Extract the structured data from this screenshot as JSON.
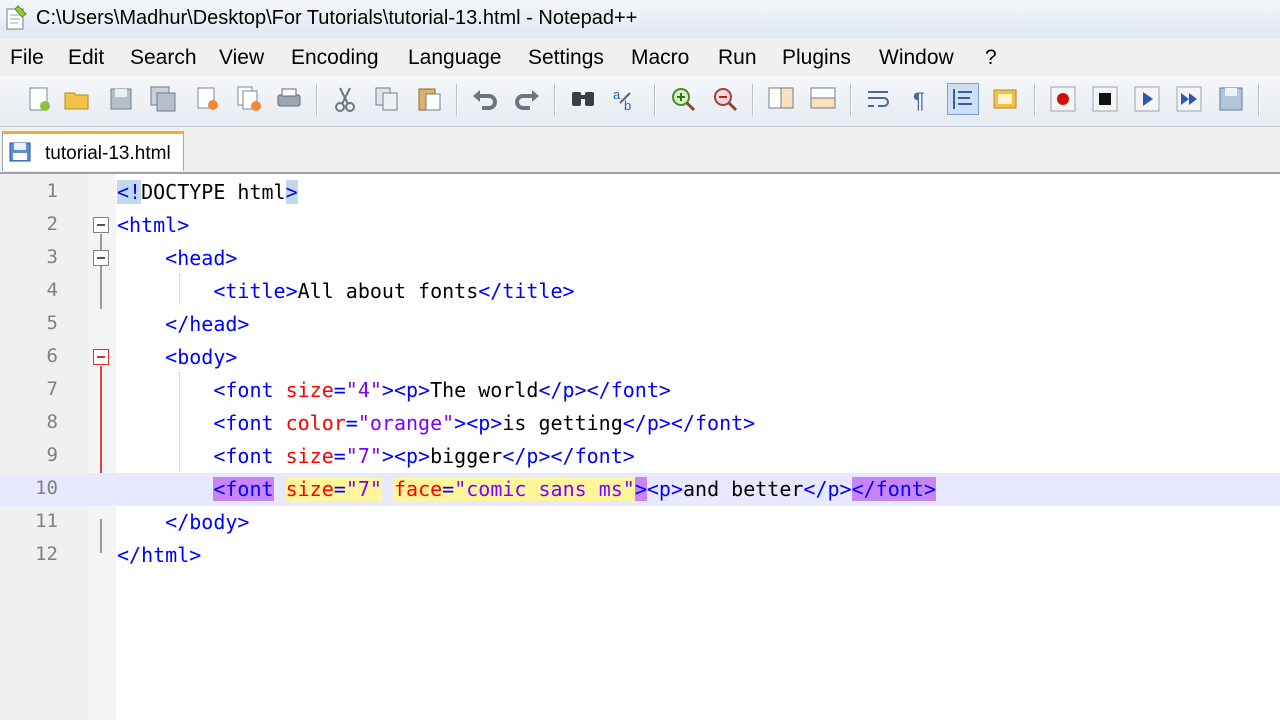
{
  "window": {
    "title": "C:\\Users\\Madhur\\Desktop\\For Tutorials\\tutorial-13.html - Notepad++"
  },
  "menu": [
    "File",
    "Edit",
    "Search",
    "View",
    "Encoding",
    "Language",
    "Settings",
    "Macro",
    "Run",
    "Plugins",
    "Window",
    "?"
  ],
  "toolbar": {
    "buttons": [
      "new-file",
      "open-file",
      "save",
      "save-all",
      "close",
      "close-all",
      "print",
      "cut",
      "copy",
      "paste",
      "undo",
      "redo",
      "find",
      "replace",
      "zoom-in",
      "zoom-out",
      "sync-vertical",
      "sync-horizontal",
      "word-wrap",
      "show-all-characters",
      "indent-guide",
      "doc-map",
      "macro-record",
      "macro-stop",
      "macro-play",
      "macro-run-multiple",
      "macro-save"
    ]
  },
  "tabs": [
    {
      "label": "tutorial-13.html",
      "active": true
    }
  ],
  "editor": {
    "current_line": 10,
    "lines": [
      {
        "n": "1",
        "tokens": [
          {
            "t": "<!",
            "c": "tag",
            "hl": "blue"
          },
          {
            "t": "DOCTYPE html",
            "c": "txt"
          },
          {
            "t": ">",
            "c": "tag",
            "hl": "blue"
          }
        ]
      },
      {
        "n": "2",
        "tokens": [
          {
            "t": "<html>",
            "c": "tag"
          }
        ]
      },
      {
        "n": "3",
        "tokens": [
          {
            "t": "    <head>",
            "c": "tag"
          }
        ]
      },
      {
        "n": "4",
        "tokens": [
          {
            "t": "        <title>",
            "c": "tag"
          },
          {
            "t": "All about fonts",
            "c": "txt"
          },
          {
            "t": "</title>",
            "c": "tag"
          }
        ]
      },
      {
        "n": "5",
        "tokens": [
          {
            "t": "    </head>",
            "c": "tag"
          }
        ]
      },
      {
        "n": "6",
        "tokens": [
          {
            "t": "    <body>",
            "c": "tag"
          }
        ]
      },
      {
        "n": "7",
        "tokens": [
          {
            "t": "        <font ",
            "c": "tag"
          },
          {
            "t": "size",
            "c": "attr"
          },
          {
            "t": "=",
            "c": "tag"
          },
          {
            "t": "\"4\"",
            "c": "val"
          },
          {
            "t": "><p>",
            "c": "tag"
          },
          {
            "t": "The world",
            "c": "txt"
          },
          {
            "t": "</p></font>",
            "c": "tag"
          }
        ]
      },
      {
        "n": "8",
        "tokens": [
          {
            "t": "        <font ",
            "c": "tag"
          },
          {
            "t": "color",
            "c": "attr"
          },
          {
            "t": "=",
            "c": "tag"
          },
          {
            "t": "\"orange\"",
            "c": "val"
          },
          {
            "t": "><p>",
            "c": "tag"
          },
          {
            "t": "is getting",
            "c": "txt"
          },
          {
            "t": "</p></font>",
            "c": "tag"
          }
        ]
      },
      {
        "n": "9",
        "tokens": [
          {
            "t": "        <font ",
            "c": "tag"
          },
          {
            "t": "size",
            "c": "attr"
          },
          {
            "t": "=",
            "c": "tag"
          },
          {
            "t": "\"7\"",
            "c": "val"
          },
          {
            "t": "><p>",
            "c": "tag"
          },
          {
            "t": "bigger",
            "c": "txt"
          },
          {
            "t": "</p></font>",
            "c": "tag"
          }
        ]
      },
      {
        "n": "10",
        "tokens": [
          {
            "t": "        ",
            "c": "txt"
          },
          {
            "t": "<font",
            "c": "tag",
            "hl": "purple"
          },
          {
            "t": " ",
            "c": "tag"
          },
          {
            "t": "size",
            "c": "attr",
            "hl": "yellow"
          },
          {
            "t": "=",
            "c": "tag",
            "hl": "yellow"
          },
          {
            "t": "\"7\"",
            "c": "val",
            "hl": "yellow"
          },
          {
            "t": " ",
            "c": "tag"
          },
          {
            "t": "face",
            "c": "attr",
            "hl": "yellow"
          },
          {
            "t": "=",
            "c": "tag",
            "hl": "yellow"
          },
          {
            "t": "\"comic sans ms\"",
            "c": "val",
            "hl": "yellow"
          },
          {
            "t": ">",
            "c": "tag",
            "hl": "purple"
          },
          {
            "t": "<p>",
            "c": "tag"
          },
          {
            "t": "and better",
            "c": "txt"
          },
          {
            "t": "</p>",
            "c": "tag"
          },
          {
            "t": "</font>",
            "c": "tag",
            "hl": "purple"
          }
        ]
      },
      {
        "n": "11",
        "tokens": [
          {
            "t": "    </body>",
            "c": "tag"
          }
        ]
      },
      {
        "n": "12",
        "tokens": [
          {
            "t": "</html>",
            "c": "tag"
          }
        ]
      }
    ]
  },
  "colors": {
    "tag": "#0000ff",
    "attr": "#ff0000",
    "value": "#8000ff",
    "text": "#000000",
    "current_line": "#e8e8ff",
    "fold_active": "#e84040",
    "tab_accent": "#f7a83a"
  }
}
